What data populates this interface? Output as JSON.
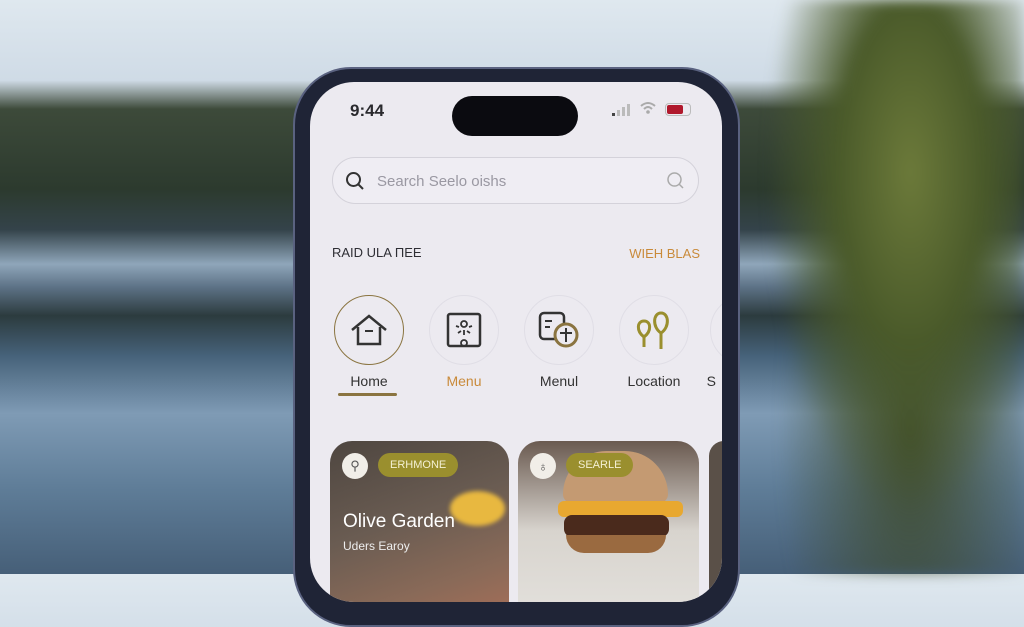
{
  "status": {
    "time": "9:44",
    "battery_color": "#b0182c"
  },
  "search": {
    "placeholder": "Search Seelo oishs"
  },
  "section": {
    "title": "RAID ULA ΠEE",
    "link": "WIEH BLAS"
  },
  "categories": [
    {
      "label": "Home",
      "icon": "home-icon",
      "active": true
    },
    {
      "label": "Menu",
      "icon": "menu-icon"
    },
    {
      "label": "Menul",
      "icon": "menu-add-icon"
    },
    {
      "label": "Location",
      "icon": "location-pin-icon"
    },
    {
      "label": "S"
    }
  ],
  "cards": [
    {
      "badge": "ERHMONE",
      "title": "Olive Garden",
      "subtitle": "Uders Earoy"
    },
    {
      "badge": "SEARLE"
    }
  ],
  "colors": {
    "accent": "#c98a3a",
    "olive": "#9a8f2e"
  }
}
